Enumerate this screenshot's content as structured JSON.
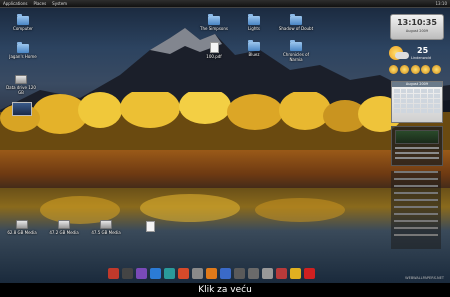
{
  "topbar": {
    "menus": [
      "Applications",
      "Places",
      "System"
    ],
    "tray_time": "13:10"
  },
  "desktop_icons": [
    {
      "label": "Computer",
      "type": "folder",
      "icon": "computer-icon"
    },
    {
      "label": "Jagan's Home",
      "type": "folder",
      "icon": "home-folder-icon"
    },
    {
      "label": "Data drive 120 GB",
      "type": "drive",
      "icon": "drive-icon"
    },
    {
      "label": "",
      "type": "thumb",
      "icon": "image-thumbnail-icon"
    },
    {
      "label": "The Simpsons",
      "type": "folder",
      "icon": "folder-icon"
    },
    {
      "label": "Lights",
      "type": "folder",
      "icon": "folder-icon"
    },
    {
      "label": "Shadow of Doubt",
      "type": "folder",
      "icon": "folder-icon"
    },
    {
      "label": "100.pdf",
      "type": "doc",
      "icon": "pdf-document-icon"
    },
    {
      "label": "Bluez",
      "type": "folder",
      "icon": "folder-icon"
    },
    {
      "label": "Chronicles of Narnia",
      "type": "folder",
      "icon": "folder-icon"
    },
    {
      "label": "62.8 GB Media",
      "type": "drive",
      "icon": "drive-icon"
    },
    {
      "label": "47.2 GB Media",
      "type": "drive",
      "icon": "drive-icon"
    },
    {
      "label": "47.5 GB Media",
      "type": "drive",
      "icon": "drive-icon"
    },
    {
      "label": "",
      "type": "doc",
      "icon": "trash-icon"
    }
  ],
  "widgets": {
    "clock_time": "13:10:35",
    "clock_date": "August 2009",
    "weather_temp": "25",
    "weather_city": "Lindenwold",
    "calendar_title": "August 2009"
  },
  "dock": {
    "items": [
      {
        "icon": "arrow-icon",
        "color": "#c0392b"
      },
      {
        "icon": "terminal-icon",
        "color": "#444444"
      },
      {
        "icon": "chat-icon",
        "color": "#7a4ab8"
      },
      {
        "icon": "network-icon",
        "color": "#2b7bd6"
      },
      {
        "icon": "globe-icon",
        "color": "#2a9a9a"
      },
      {
        "icon": "media-icon",
        "color": "#d64a2a"
      },
      {
        "icon": "settings-icon",
        "color": "#8a8a8a"
      },
      {
        "icon": "firefox-icon",
        "color": "#e07a1a"
      },
      {
        "icon": "mail-icon",
        "color": "#3a6ac8"
      },
      {
        "icon": "monitor-icon",
        "color": "#5a5a5a"
      },
      {
        "icon": "display-icon",
        "color": "#6a6a6a"
      },
      {
        "icon": "drive-icon",
        "color": "#999999"
      },
      {
        "icon": "calendar-icon",
        "color": "#b83a3a"
      },
      {
        "icon": "lamp-icon",
        "color": "#e0b020"
      },
      {
        "icon": "close-icon",
        "color": "#d02020"
      }
    ]
  },
  "watermark": "WEBWALLPAPERS.NET",
  "caption": "Klik za veću"
}
